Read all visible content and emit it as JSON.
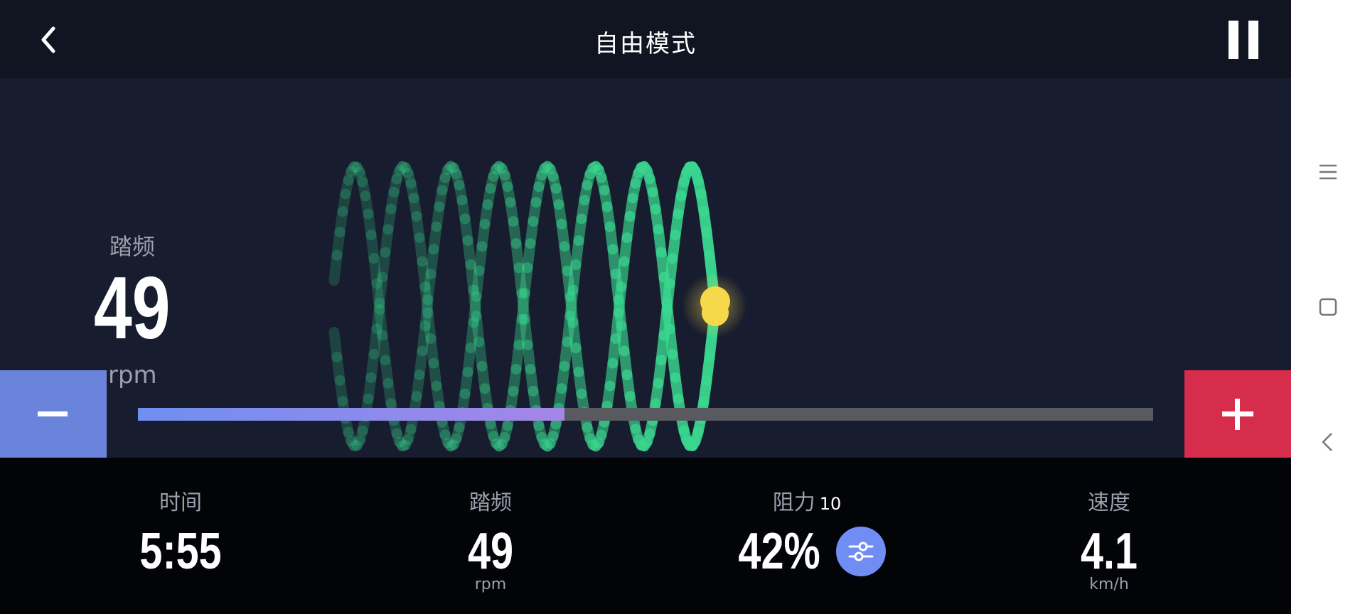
{
  "header": {
    "title": "自由模式",
    "back_icon": "chevron-left-icon",
    "pause_icon": "pause-icon"
  },
  "main": {
    "cadence_label": "踏频",
    "cadence_value": "49",
    "cadence_unit": "rpm",
    "minus_icon": "minus-icon",
    "plus_icon": "plus-icon",
    "resistance_progress": 0.42,
    "colors": {
      "wave": "#3ad68f",
      "indicator": "#f5d94a",
      "minus_bg": "#6a84dc",
      "plus_bg": "#d52d4b",
      "progress_start": "#6f8ff0",
      "progress_end": "#a486e8"
    }
  },
  "stats": {
    "time": {
      "label": "时间",
      "value": "5:55"
    },
    "cadence": {
      "label": "踏频",
      "value": "49",
      "unit": "rpm"
    },
    "resistance": {
      "label": "阻力",
      "level": "10",
      "value": "42%",
      "icon": "sliders-icon"
    },
    "speed": {
      "label": "速度",
      "value": "4.1",
      "unit": "km/h"
    }
  },
  "system_nav": [
    "menu-icon",
    "home-square-icon",
    "back-icon"
  ]
}
